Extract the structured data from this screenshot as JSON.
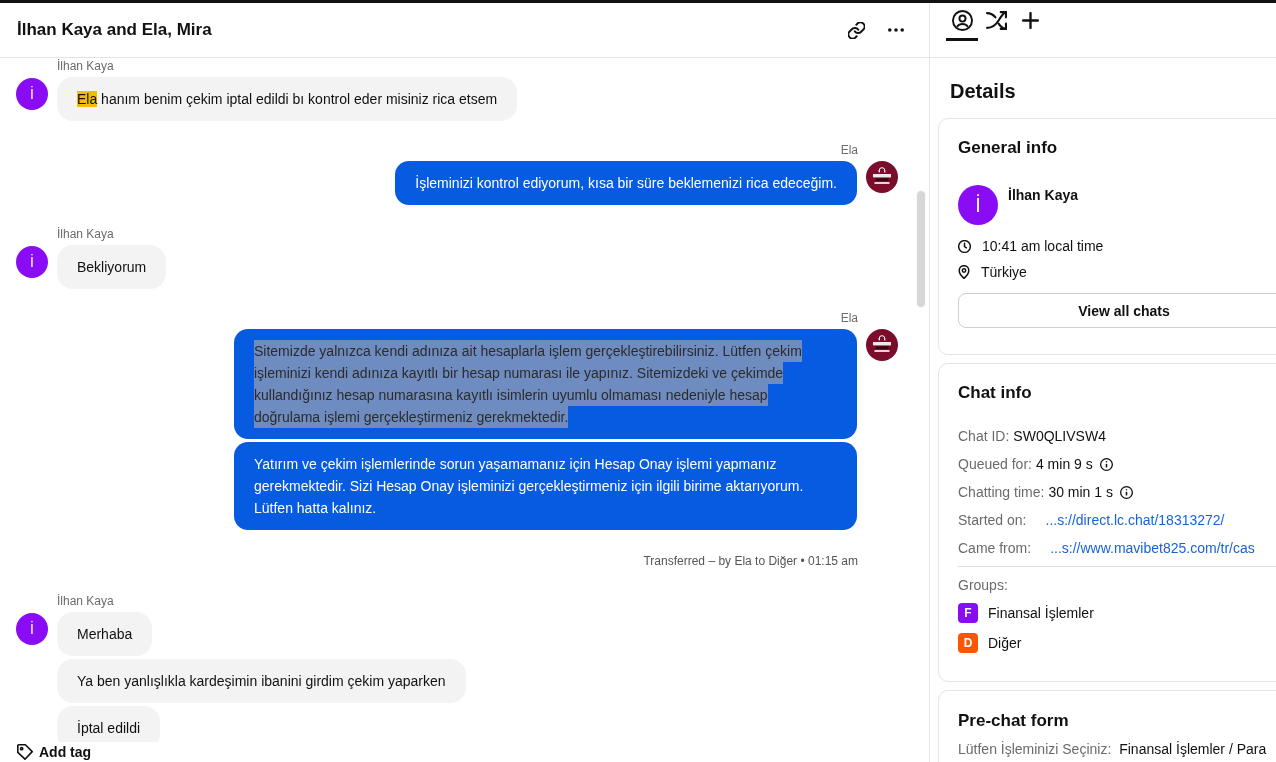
{
  "conversation": {
    "title": "İlhan Kaya and Ela, Mira"
  },
  "messages": [
    {
      "kind": "customer",
      "author": "İlhan Kaya",
      "initial": "İ",
      "bubbles": [
        {
          "mention": "Ela",
          "text": " hanım benim çekim iptal edildi bı kontrol eder misiniz rica etsem",
          "selected": false
        }
      ]
    },
    {
      "kind": "agent",
      "author": "Ela",
      "bubbles": [
        {
          "text": "İşleminizi kontrol ediyorum, kısa bir süre beklemenizi rica edeceğim.",
          "selected": false
        }
      ]
    },
    {
      "kind": "customer",
      "author": "İlhan Kaya",
      "initial": "İ",
      "bubbles": [
        {
          "text": "Bekliyorum",
          "selected": false
        }
      ]
    },
    {
      "kind": "agent",
      "author": "Ela",
      "bubbles": [
        {
          "text": "Sitemizde yalnızca kendi adınıza ait hesaplarla işlem gerçekleştirebilirsiniz. Lütfen çekim işleminizi kendi adınıza kayıtlı bir hesap numarası ile yapınız. Sitemizdeki ve çekimde kullandığınız hesap numarasına kayıtlı isimlerin uyumlu olmaması nedeniyle hesap doğrulama işlemi gerçekleştirmeniz gerekmektedir.",
          "selected": true
        },
        {
          "text": "Yatırım ve çekim işlemlerinde sorun yaşamamanız için Hesap Onay işlemi yapmanız gerekmektedir. Sizi Hesap Onay işleminizi gerçekleştirmeniz için ilgili birime aktarıyorum. Lütfen hatta kalınız.",
          "selected": false
        }
      ]
    },
    {
      "kind": "system",
      "text": "Transferred – by Ela to Diğer • 01:15 am"
    },
    {
      "kind": "customer",
      "author": "İlhan Kaya",
      "initial": "İ",
      "bubbles": [
        {
          "text": "Merhaba",
          "selected": false
        },
        {
          "text": "Ya ben yanlışlıkla kardeşimin ibanini girdim çekim yaparken",
          "selected": false
        },
        {
          "text": "İptal edildi",
          "selected": false
        }
      ]
    }
  ],
  "footer": {
    "add_tag": "Add tag"
  },
  "side_panel": {
    "tabs": [
      {
        "kind": "profile",
        "selected": true
      },
      {
        "kind": "shuffle",
        "selected": false
      },
      {
        "kind": "add",
        "selected": false
      }
    ],
    "title": "Details",
    "general_info": {
      "title": "General info",
      "customer": {
        "initial": "İ",
        "name": "İlhan Kaya"
      },
      "local_time": "10:41 am local time",
      "location": "Türkiye",
      "button": "View all chats"
    },
    "chat_info": {
      "title": "Chat info",
      "fields": [
        {
          "kind": "text",
          "label": "Chat ID:",
          "value": "SW0QLIVSW4"
        },
        {
          "kind": "info",
          "label": "Queued for:",
          "value": "4 min 9 s"
        },
        {
          "kind": "info",
          "label": "Chatting time:",
          "value": "30 min 1 s"
        },
        {
          "kind": "link",
          "label": "Started on:",
          "value": "...s://direct.lc.chat/18313272/"
        },
        {
          "kind": "link",
          "label": "Came from:",
          "value": "...s://www.mavibet825.com/tr/cas"
        }
      ],
      "groups_label": "Groups:",
      "groups": [
        {
          "initial": "F",
          "name": "Finansal İşlemler",
          "color": "#8a0cf5"
        },
        {
          "initial": "D",
          "name": "Diğer",
          "color": "#ff5500"
        }
      ]
    },
    "pre_chat_form": {
      "title": "Pre-chat form",
      "fields": [
        {
          "label": "Lütfen İşleminizi Seçiniz:",
          "value": "Finansal İşlemler / Para"
        }
      ]
    }
  }
}
